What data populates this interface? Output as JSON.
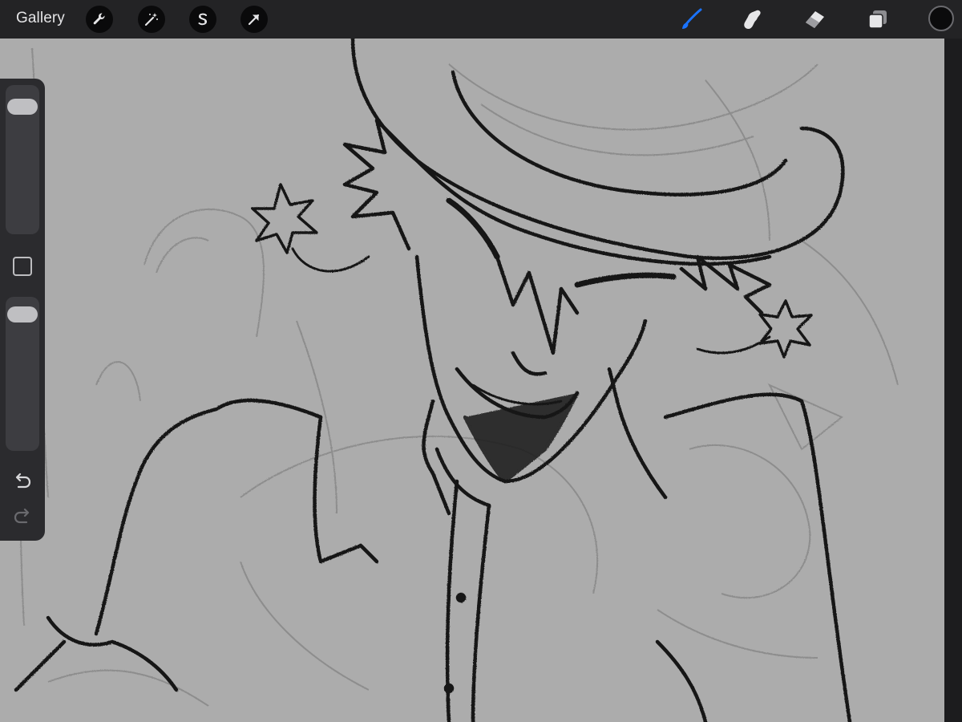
{
  "toolbar": {
    "gallery_label": "Gallery",
    "left_tools": [
      "wrench-icon",
      "magic-wand-icon",
      "selection-s-icon",
      "transform-arrow-icon"
    ],
    "right_tools": [
      "brush-icon",
      "smudge-icon",
      "eraser-icon",
      "layers-icon"
    ],
    "active_tool": "brush-icon",
    "active_color": "#0b0b0c",
    "accent_color": "#1a73ff"
  },
  "sidebar": {
    "brush_size_level": 0.08,
    "opacity_level": 0.05,
    "controls": [
      "brush-size-slider",
      "modify-button",
      "opacity-slider",
      "undo-button",
      "redo-button"
    ]
  },
  "canvas": {
    "background_color": "#acacac",
    "content": "sketch"
  }
}
